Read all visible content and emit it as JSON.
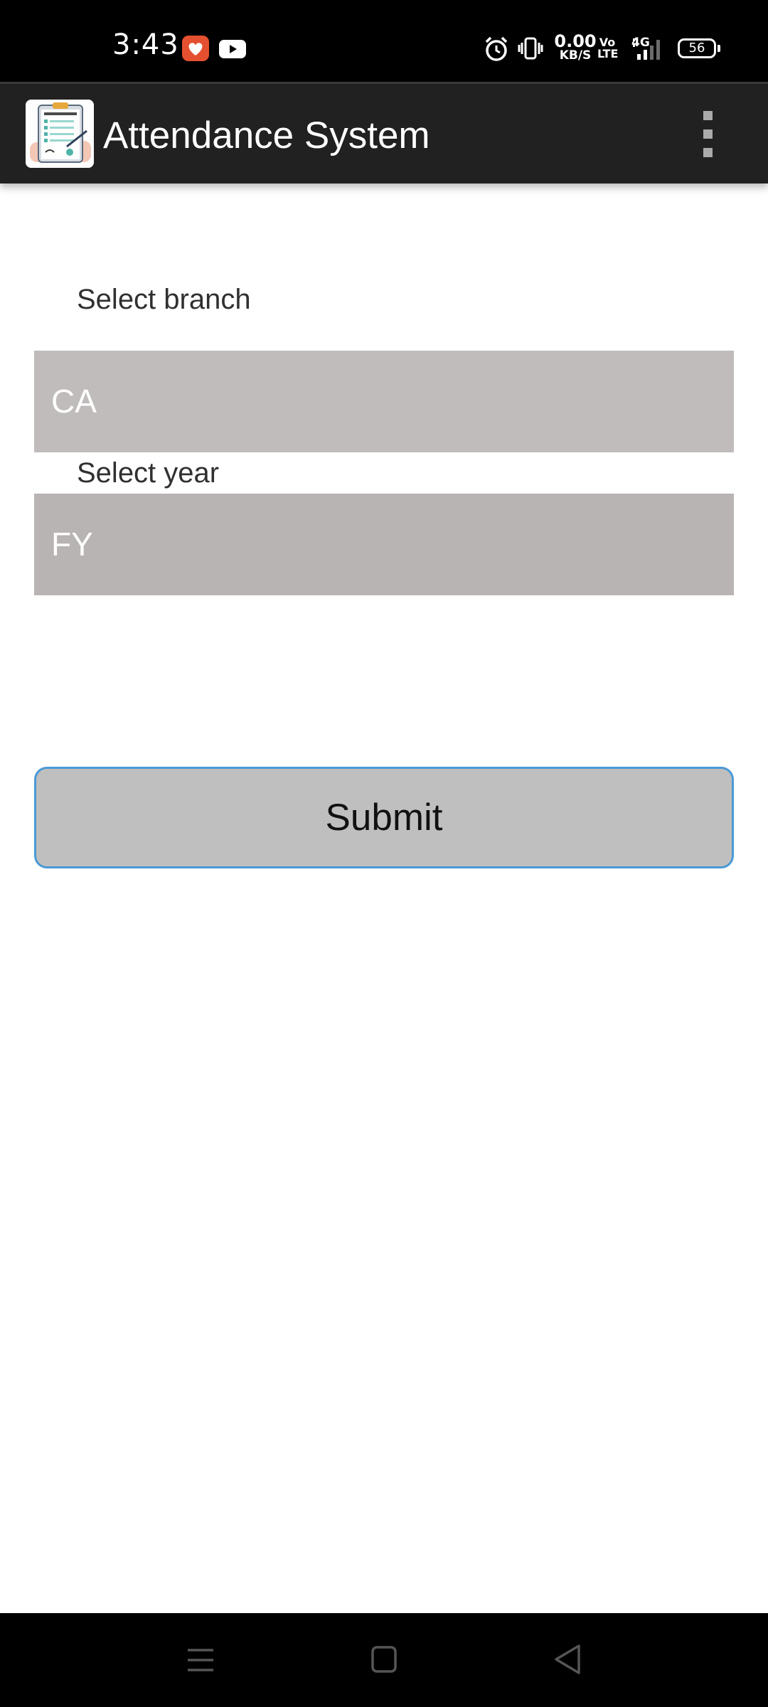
{
  "status_bar": {
    "time": "3:43",
    "net_speed_value": "0.00",
    "net_speed_unit": "KB/S",
    "volte_top": "Vo",
    "volte_bottom": "LTE",
    "network_type": "4G",
    "battery_level": "56"
  },
  "app_bar": {
    "title": "Attendance System",
    "logo_icon": "attendance-clipboard-icon",
    "menu_icon": "more-vertical-icon"
  },
  "form": {
    "branch_label": "Select branch",
    "branch_value": "CA",
    "year_label": "Select year",
    "year_value": "FY",
    "submit_label": "Submit"
  },
  "nav_bar": {
    "icons": [
      "menu-icon",
      "home-icon",
      "back-icon"
    ]
  },
  "colors": {
    "status_bar": "#000000",
    "app_bar": "#212121",
    "branch_spinner": "#c0bcbb",
    "year_spinner": "#b8b4b3",
    "submit_background": "#bfbfbf",
    "submit_border": "#4a9ad6",
    "health_app": "#e4502f"
  }
}
